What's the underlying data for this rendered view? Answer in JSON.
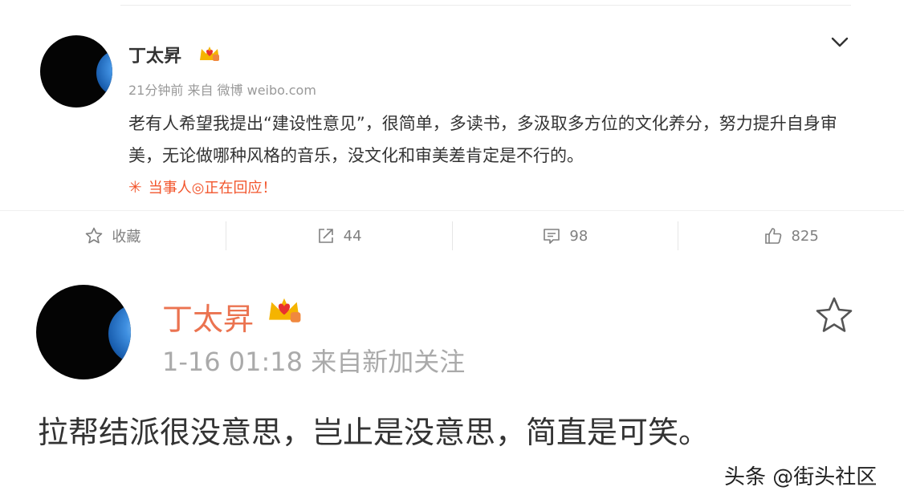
{
  "post1": {
    "author": "丁太昇",
    "meta": "21分钟前 来自 微博 weibo.com",
    "text": "老有人希望我提出“建设性意见”，很简单，多读书，多汲取多方位的文化养分，努力提升自身审美，无论做哪种风格的音乐，没文化和审美差肯定是不行的。",
    "reply_notice": "当事人◎正在回应！",
    "actions": {
      "favorite_label": "收藏",
      "repost_count": "44",
      "comment_count": "98",
      "like_count": "825"
    }
  },
  "post2": {
    "author": "丁太昇",
    "meta": "1-16 01:18 来自新加关注",
    "text": "拉帮结派很没意思，岂止是没意思，简直是可笑。"
  },
  "watermark": "头条 @街头社区",
  "icons": [
    "avatar",
    "vip-crown-icon",
    "chevron-down-icon",
    "star-icon",
    "share-icon",
    "comment-icon",
    "thumbs-up-icon"
  ],
  "colors": {
    "accent_orange": "#eb7350",
    "reply_red": "#f2552c",
    "muted": "#999999"
  }
}
